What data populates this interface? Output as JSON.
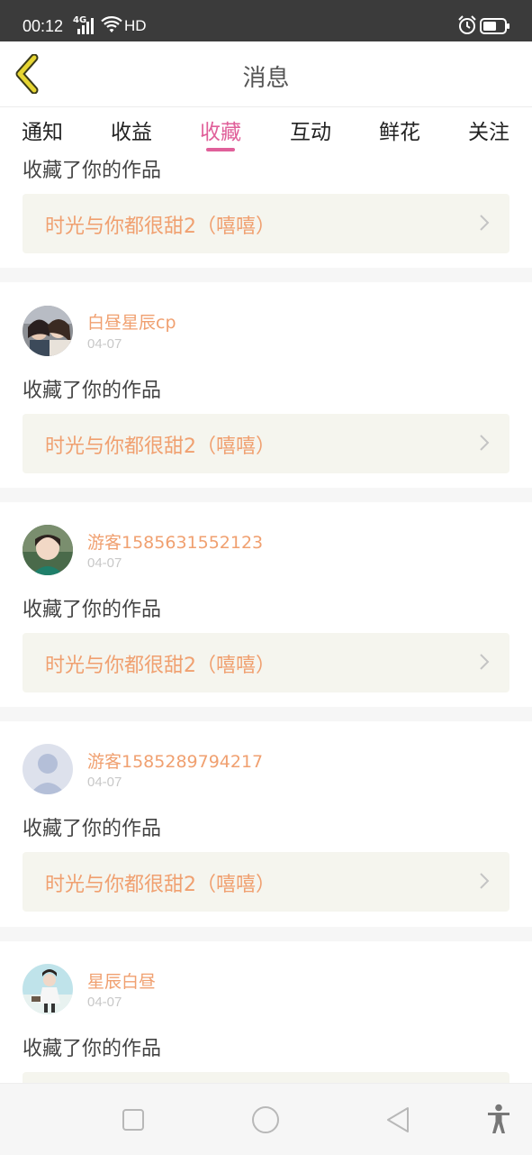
{
  "status_bar": {
    "time": "00:12",
    "network": "4G",
    "hd": "HD",
    "icons": [
      "signal-icon",
      "wifi-icon",
      "alarm-icon",
      "battery-icon"
    ]
  },
  "header": {
    "title": "消息",
    "back_icon": "chevron-left-icon",
    "back_color": "#d6c429"
  },
  "tabs": [
    {
      "label": "通知",
      "active": false
    },
    {
      "label": "收益",
      "active": false
    },
    {
      "label": "收藏",
      "active": true
    },
    {
      "label": "互动",
      "active": false
    },
    {
      "label": "鲜花",
      "active": false
    },
    {
      "label": "关注",
      "active": false
    }
  ],
  "accent_color": "#e0609a",
  "name_color": "#f0a070",
  "partial_card": {
    "action": "收藏了你的作品",
    "work_title": "时光与你都很甜2（嘻嘻）"
  },
  "items": [
    {
      "user": "白昼星辰cp",
      "date": "04-07",
      "action": "收藏了你的作品",
      "work_title": "时光与你都很甜2（嘻嘻）"
    },
    {
      "user": "游客1585631552123",
      "date": "04-07",
      "action": "收藏了你的作品",
      "work_title": "时光与你都很甜2（嘻嘻）"
    },
    {
      "user": "游客1585289794217",
      "date": "04-07",
      "action": "收藏了你的作品",
      "work_title": "时光与你都很甜2（嘻嘻）"
    },
    {
      "user": "星辰白昼",
      "date": "04-07",
      "action": "收藏了你的作品",
      "work_title": ""
    }
  ],
  "nav_bar": {
    "icons": [
      "square-recents-icon",
      "circle-home-icon",
      "triangle-back-icon",
      "accessibility-icon"
    ]
  }
}
